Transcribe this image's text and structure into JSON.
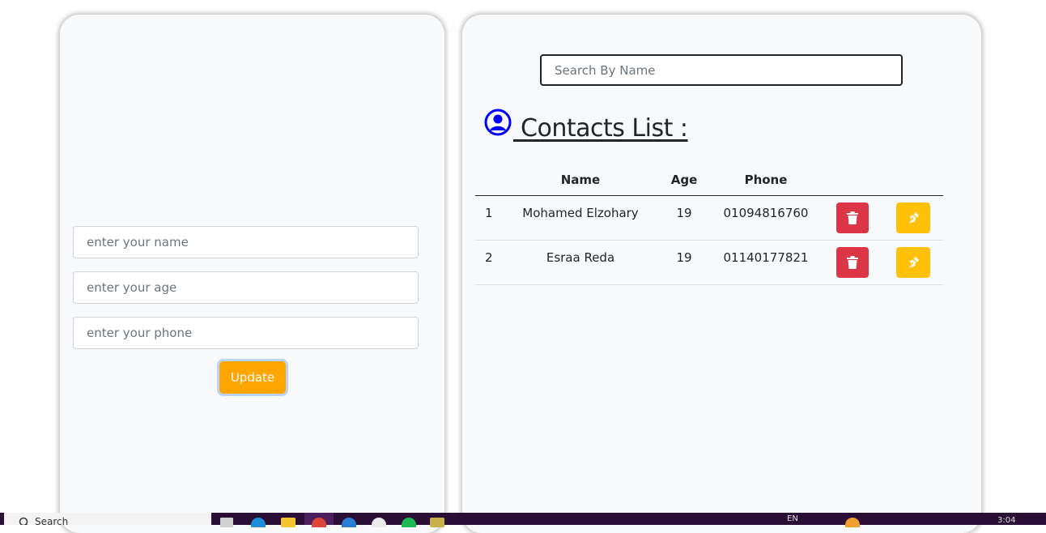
{
  "form": {
    "name_placeholder": "enter your name",
    "age_placeholder": "enter your age",
    "phone_placeholder": "enter your phone",
    "update_label": "Update"
  },
  "list": {
    "search_placeholder": "Search By Name",
    "title": " Contacts List :",
    "columns": [
      "",
      "Name",
      "Age",
      "Phone",
      "",
      ""
    ],
    "rows": [
      {
        "index": "1",
        "name": "Mohamed Elzohary",
        "age": "19",
        "phone": "01094816760"
      },
      {
        "index": "2",
        "name": "Esraa Reda",
        "age": "19",
        "phone": "01140177821"
      }
    ],
    "icons": {
      "heading": "user-circle-icon",
      "delete": "trash-icon",
      "edit": "pen-nib-icon"
    }
  },
  "taskbar": {
    "search_label": "Search",
    "language": "EN",
    "clock": "3:04"
  },
  "colors": {
    "update": "#ffa500",
    "delete": "#dc3545",
    "edit": "#ffc107",
    "heading_icon": "#0000ff",
    "card_bg": "#f8f9fa"
  }
}
